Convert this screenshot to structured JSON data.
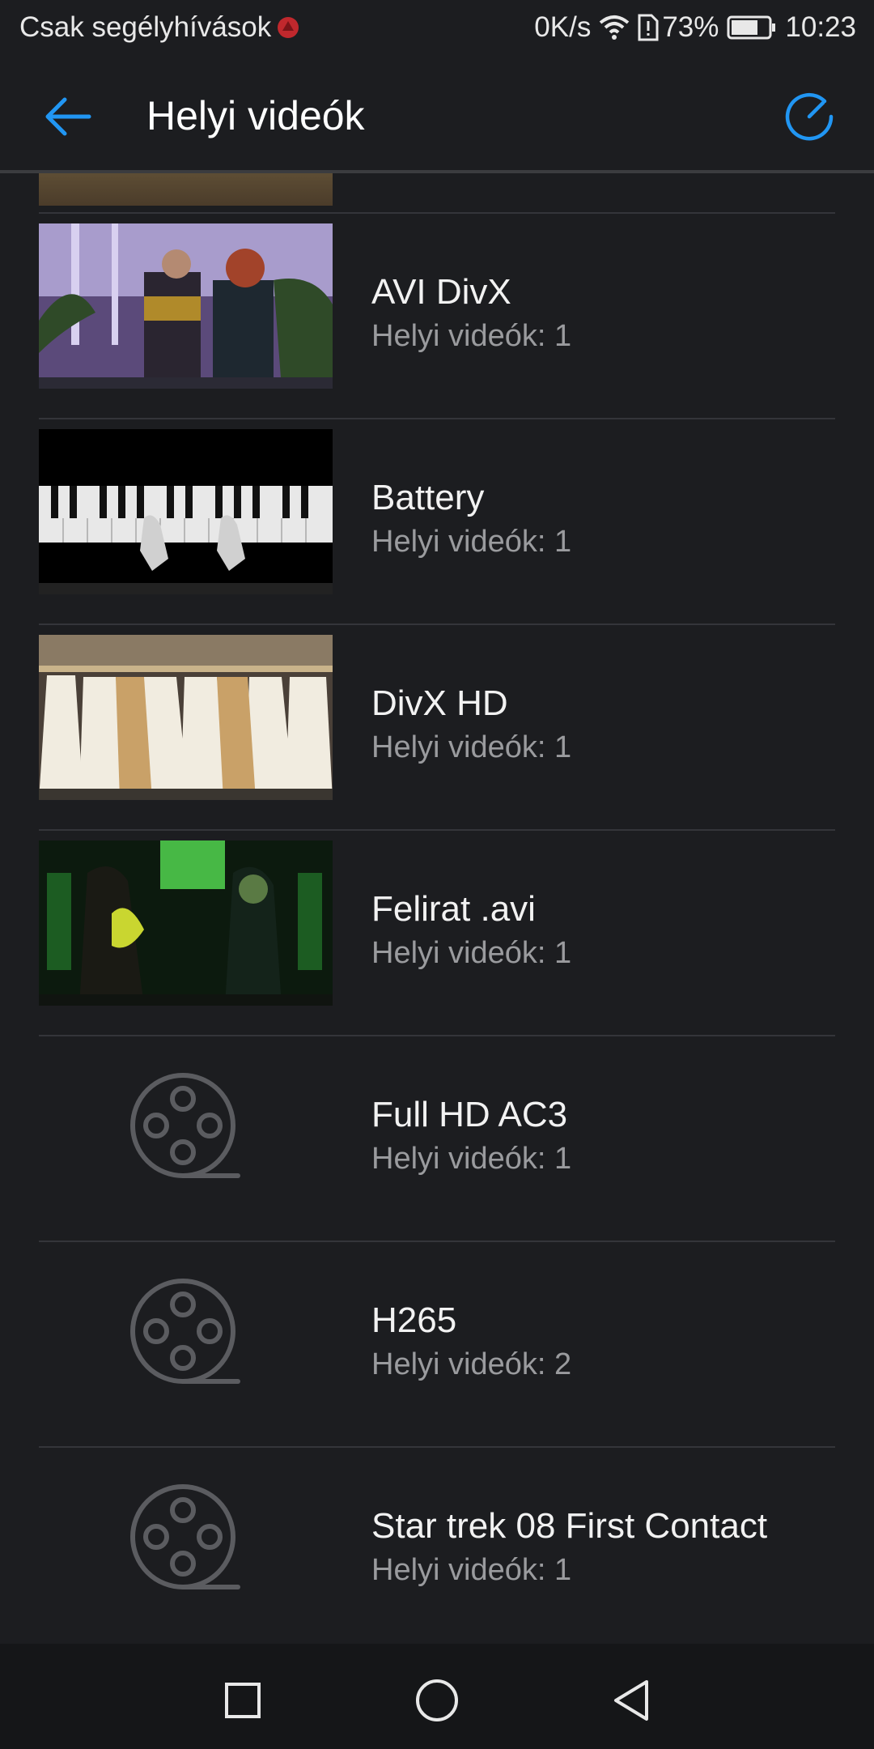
{
  "status_bar": {
    "carrier": "Csak segélyhívások",
    "speed": "0K/s",
    "battery_percent": "73%",
    "time": "10:23",
    "battery_level": 0.73
  },
  "app_bar": {
    "title": "Helyi videók",
    "accent_color": "#2196f3"
  },
  "videos": [
    {
      "title": "AVI DivX",
      "subtitle": "Helyi videók: 1",
      "thumbnail": "scene-image"
    },
    {
      "title": "Battery",
      "subtitle": "Helyi videók: 1",
      "thumbnail": "piano-image"
    },
    {
      "title": "DivX HD",
      "subtitle": "Helyi videók: 1",
      "thumbnail": "clothes-image"
    },
    {
      "title": "Felirat .avi",
      "subtitle": "Helyi videók: 1",
      "thumbnail": "green-scene-image"
    },
    {
      "title": "Full HD AC3",
      "subtitle": "Helyi videók: 1",
      "thumbnail": "film-reel-icon"
    },
    {
      "title": "H265",
      "subtitle": "Helyi videók: 2",
      "thumbnail": "film-reel-icon"
    },
    {
      "title": "Star trek 08 First Contact",
      "subtitle": "Helyi videók: 1",
      "thumbnail": "film-reel-icon"
    }
  ]
}
